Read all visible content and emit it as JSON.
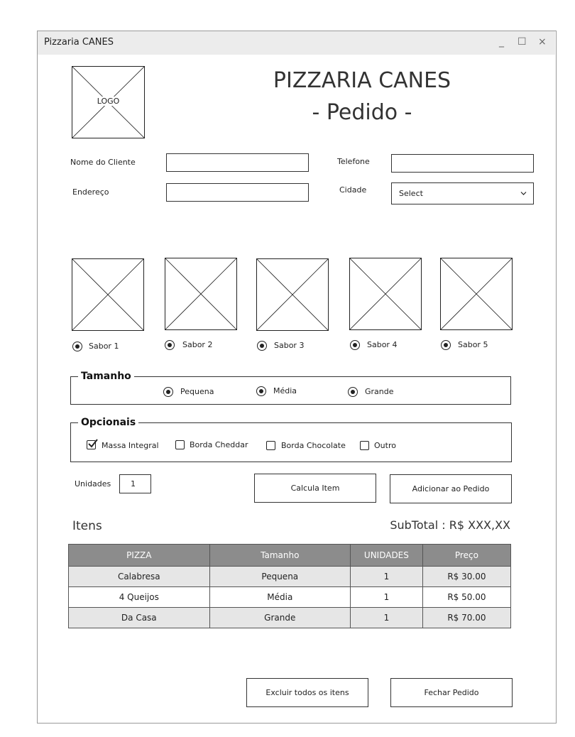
{
  "window": {
    "title": "Pizzaria CANES",
    "minimize": "_",
    "maximize": "☐",
    "close": "×"
  },
  "header": {
    "logo_text": "LOGO",
    "title": "PIZZARIA CANES",
    "subtitle": "- Pedido -"
  },
  "form": {
    "nome_label": "Nome do Cliente",
    "nome_value": "",
    "telefone_label": "Telefone",
    "telefone_value": "",
    "endereco_label": "Endereço",
    "endereco_value": "",
    "cidade_label": "Cidade",
    "cidade_value": "Select"
  },
  "flavors": [
    {
      "label": "Sabor 1",
      "selected": true
    },
    {
      "label": "Sabor 2",
      "selected": true
    },
    {
      "label": "Sabor 3",
      "selected": true
    },
    {
      "label": "Sabor 4",
      "selected": true
    },
    {
      "label": "Sabor 5",
      "selected": true
    }
  ],
  "tamanho": {
    "legend": "Tamanho",
    "options": [
      {
        "label": "Pequena",
        "selected": true
      },
      {
        "label": "Média",
        "selected": true
      },
      {
        "label": "Grande",
        "selected": true
      }
    ]
  },
  "opcionais": {
    "legend": "Opcionais",
    "options": [
      {
        "label": "Massa Integral",
        "checked": true
      },
      {
        "label": "Borda Cheddar",
        "checked": false
      },
      {
        "label": "Borda Chocolate",
        "checked": false
      },
      {
        "label": "Outro",
        "checked": false
      }
    ]
  },
  "unidades": {
    "label": "Unidades",
    "value": "1"
  },
  "actions": {
    "calcula": "Calcula Item",
    "adicionar": "Adicionar ao Pedido"
  },
  "itens": {
    "title": "Itens",
    "subtotal": "SubTotal : R$ XXX,XX",
    "columns": [
      "PIZZA",
      "Tamanho",
      "UNIDADES",
      "Preço"
    ],
    "rows": [
      [
        "Calabresa",
        "Pequena",
        "1",
        "R$ 30.00"
      ],
      [
        "4 Queijos",
        "Média",
        "1",
        "R$ 50.00"
      ],
      [
        "Da Casa",
        "Grande",
        "1",
        "R$ 70.00"
      ]
    ]
  },
  "footer": {
    "excluir": "Excluir todos os itens",
    "fechar": "Fechar Pedido"
  },
  "colors": {
    "table_header": "#8c8c8c",
    "row_shade": "#e6e6e6",
    "titlebar": "#ececec"
  }
}
